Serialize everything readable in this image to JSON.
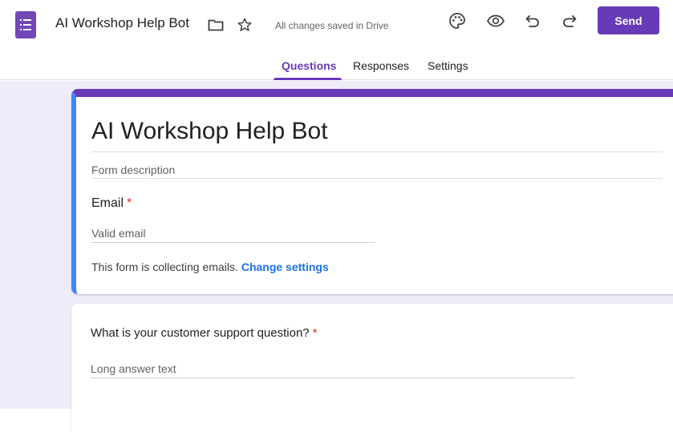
{
  "topbar": {
    "form_title": "AI Workshop Help Bot",
    "saved_status": "All changes saved in Drive",
    "send_label": "Send",
    "icons": [
      "forms-app-icon",
      "folder-icon",
      "star-icon",
      "palette-icon",
      "eye-icon",
      "undo-icon",
      "redo-icon"
    ]
  },
  "tabs": [
    {
      "label": "Questions",
      "active": true
    },
    {
      "label": "Responses",
      "active": false
    },
    {
      "label": "Settings",
      "active": false
    }
  ],
  "header_card": {
    "title": "AI Workshop Help Bot",
    "description_placeholder": "Form description",
    "email_label": "Email",
    "required_mark": "*",
    "email_placeholder": "Valid email",
    "collecting_text": "This form is collecting emails.",
    "change_settings_label": "Change settings"
  },
  "question_card": {
    "title": "What is your customer support question?",
    "required_mark": "*",
    "answer_placeholder": "Long answer text"
  },
  "colors": {
    "accent": "#673ab7",
    "active_card": "#4285f4",
    "background": "#f0ebf8",
    "link": "#1a73e8",
    "required": "#d93025"
  }
}
